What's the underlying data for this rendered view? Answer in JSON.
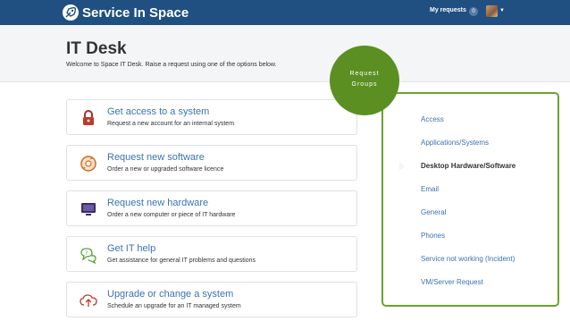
{
  "topbar": {
    "brand": "Service In Space",
    "my_requests_label": "My requests",
    "my_requests_count": "0"
  },
  "header": {
    "title": "IT Desk",
    "subtitle": "Welcome to Space IT Desk. Raise a request using one of the options below."
  },
  "requests": [
    {
      "title": "Get access to a system",
      "desc": "Request a new account for an internal system",
      "icon": "lock-icon"
    },
    {
      "title": "Request new software",
      "desc": "Order a new or upgraded software licence",
      "icon": "software-disc-icon"
    },
    {
      "title": "Request new hardware",
      "desc": "Order a new computer or piece of IT hardware",
      "icon": "monitor-icon"
    },
    {
      "title": "Get IT help",
      "desc": "Get assistance for general IT problems and questions",
      "icon": "chat-help-icon"
    },
    {
      "title": "Upgrade or change a system",
      "desc": "Schedule an upgrade for an IT managed system",
      "icon": "cloud-upload-icon"
    }
  ],
  "groups_badge": {
    "line1": "Request",
    "line2": "Groups"
  },
  "groups": [
    {
      "label": "Access",
      "active": false
    },
    {
      "label": "Applications/Systems",
      "active": false
    },
    {
      "label": "Desktop Hardware/Software",
      "active": true
    },
    {
      "label": "Email",
      "active": false
    },
    {
      "label": "General",
      "active": false
    },
    {
      "label": "Phones",
      "active": false
    },
    {
      "label": "Service not working (Incident)",
      "active": false
    },
    {
      "label": "VM/Server Request",
      "active": false
    }
  ],
  "colors": {
    "topbar": "#205081",
    "link": "#3b73af",
    "accent_green": "#6aa32e"
  }
}
